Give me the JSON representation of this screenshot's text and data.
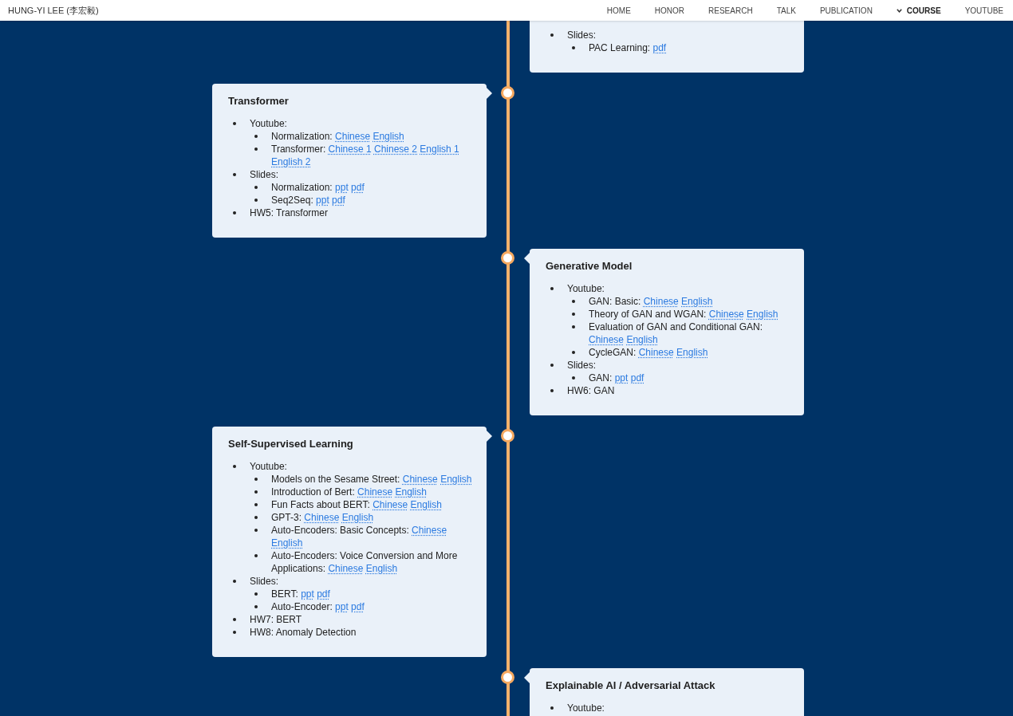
{
  "nav": {
    "brand": "HUNG-YI LEE (李宏毅)",
    "items": [
      {
        "label": "HOME",
        "selected": false
      },
      {
        "label": "HONOR",
        "selected": false
      },
      {
        "label": "RESEARCH",
        "selected": false
      },
      {
        "label": "TALK",
        "selected": false
      },
      {
        "label": "PUBLICATION",
        "selected": false
      },
      {
        "label": "COURSE",
        "selected": true
      },
      {
        "label": "YOUTUBE",
        "selected": false
      }
    ]
  },
  "timeline": [
    {
      "kind": "continued",
      "sections": [
        {
          "label": "Slides:",
          "items": [
            {
              "label": "PAC Learning:",
              "links": [
                "pdf"
              ]
            }
          ]
        }
      ]
    },
    {
      "kind": "topic",
      "title": "Transformer",
      "sections": [
        {
          "label": "Youtube:",
          "items": [
            {
              "label": "Normalization:",
              "links": [
                "Chinese",
                "English"
              ]
            },
            {
              "label": "Transformer:",
              "links": [
                "Chinese 1",
                "Chinese 2",
                "English 1",
                "English 2"
              ]
            }
          ]
        },
        {
          "label": "Slides:",
          "items": [
            {
              "label": "Normalization:",
              "links": [
                "ppt",
                "pdf"
              ]
            },
            {
              "label": "Seq2Seq:",
              "links": [
                "ppt",
                "pdf"
              ]
            }
          ]
        },
        {
          "label": "HW5: Transformer"
        }
      ]
    },
    {
      "kind": "topic",
      "title": "Generative Model",
      "sections": [
        {
          "label": "Youtube:",
          "items": [
            {
              "label": "GAN: Basic:",
              "links": [
                "Chinese",
                "English"
              ]
            },
            {
              "label": "Theory of GAN and WGAN:",
              "links": [
                "Chinese",
                "English"
              ]
            },
            {
              "label": "Evaluation of GAN and Conditional GAN:",
              "links": [
                "Chinese",
                "English"
              ]
            },
            {
              "label": "CycleGAN:",
              "links": [
                "Chinese",
                "English"
              ]
            }
          ]
        },
        {
          "label": "Slides:",
          "items": [
            {
              "label": "GAN:",
              "links": [
                "ppt",
                "pdf"
              ]
            }
          ]
        },
        {
          "label": "HW6: GAN"
        }
      ]
    },
    {
      "kind": "topic",
      "title": "Self-Supervised Learning",
      "sections": [
        {
          "label": "Youtube:",
          "items": [
            {
              "label": "Models on the Sesame Street:",
              "links": [
                "Chinese",
                "English"
              ]
            },
            {
              "label": "Introduction of Bert:",
              "links": [
                "Chinese",
                "English"
              ]
            },
            {
              "label": "Fun Facts about BERT:",
              "links": [
                "Chinese",
                "English"
              ]
            },
            {
              "label": "GPT-3:",
              "links": [
                "Chinese",
                "English"
              ]
            },
            {
              "label": "Auto-Encoders: Basic Concepts:",
              "links": [
                "Chinese",
                "English"
              ]
            },
            {
              "label": "Auto-Encoders: Voice Conversion and More Applications:",
              "links": [
                "Chinese",
                "English"
              ]
            }
          ]
        },
        {
          "label": "Slides:",
          "items": [
            {
              "label": "BERT:",
              "links": [
                "ppt",
                "pdf"
              ]
            },
            {
              "label": "Auto-Encoder:",
              "links": [
                "ppt",
                "pdf"
              ]
            }
          ]
        },
        {
          "label": "HW7: BERT"
        },
        {
          "label": "HW8: Anomaly Detection"
        }
      ]
    },
    {
      "kind": "topic",
      "title": "Explainable AI / Adversarial Attack",
      "sections": [
        {
          "label": "Youtube:"
        }
      ]
    }
  ]
}
